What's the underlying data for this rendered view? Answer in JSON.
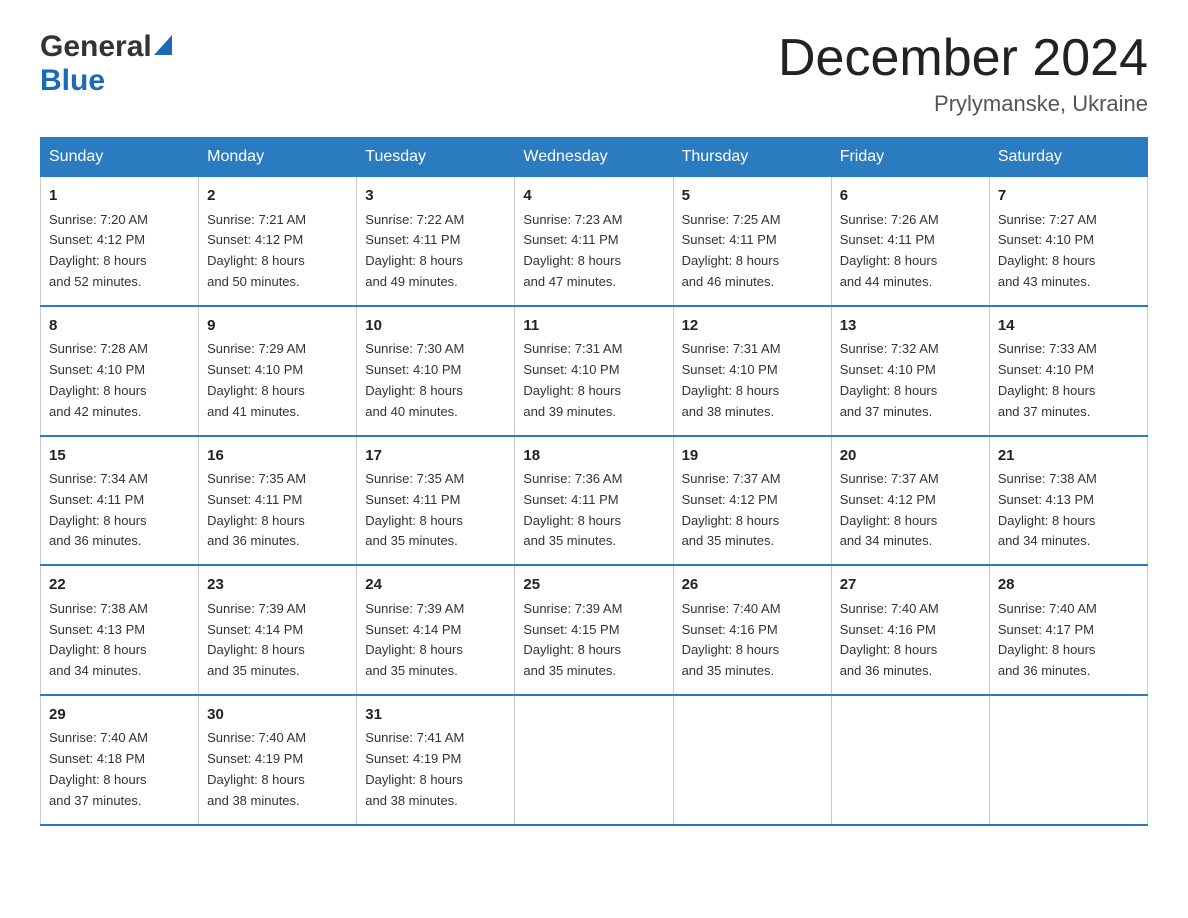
{
  "header": {
    "logo_general": "General",
    "logo_blue": "Blue",
    "title": "December 2024",
    "location": "Prylymanske, Ukraine"
  },
  "columns": [
    "Sunday",
    "Monday",
    "Tuesday",
    "Wednesday",
    "Thursday",
    "Friday",
    "Saturday"
  ],
  "weeks": [
    [
      {
        "day": "1",
        "sunrise": "7:20 AM",
        "sunset": "4:12 PM",
        "daylight": "8 hours and 52 minutes."
      },
      {
        "day": "2",
        "sunrise": "7:21 AM",
        "sunset": "4:12 PM",
        "daylight": "8 hours and 50 minutes."
      },
      {
        "day": "3",
        "sunrise": "7:22 AM",
        "sunset": "4:11 PM",
        "daylight": "8 hours and 49 minutes."
      },
      {
        "day": "4",
        "sunrise": "7:23 AM",
        "sunset": "4:11 PM",
        "daylight": "8 hours and 47 minutes."
      },
      {
        "day": "5",
        "sunrise": "7:25 AM",
        "sunset": "4:11 PM",
        "daylight": "8 hours and 46 minutes."
      },
      {
        "day": "6",
        "sunrise": "7:26 AM",
        "sunset": "4:11 PM",
        "daylight": "8 hours and 44 minutes."
      },
      {
        "day": "7",
        "sunrise": "7:27 AM",
        "sunset": "4:10 PM",
        "daylight": "8 hours and 43 minutes."
      }
    ],
    [
      {
        "day": "8",
        "sunrise": "7:28 AM",
        "sunset": "4:10 PM",
        "daylight": "8 hours and 42 minutes."
      },
      {
        "day": "9",
        "sunrise": "7:29 AM",
        "sunset": "4:10 PM",
        "daylight": "8 hours and 41 minutes."
      },
      {
        "day": "10",
        "sunrise": "7:30 AM",
        "sunset": "4:10 PM",
        "daylight": "8 hours and 40 minutes."
      },
      {
        "day": "11",
        "sunrise": "7:31 AM",
        "sunset": "4:10 PM",
        "daylight": "8 hours and 39 minutes."
      },
      {
        "day": "12",
        "sunrise": "7:31 AM",
        "sunset": "4:10 PM",
        "daylight": "8 hours and 38 minutes."
      },
      {
        "day": "13",
        "sunrise": "7:32 AM",
        "sunset": "4:10 PM",
        "daylight": "8 hours and 37 minutes."
      },
      {
        "day": "14",
        "sunrise": "7:33 AM",
        "sunset": "4:10 PM",
        "daylight": "8 hours and 37 minutes."
      }
    ],
    [
      {
        "day": "15",
        "sunrise": "7:34 AM",
        "sunset": "4:11 PM",
        "daylight": "8 hours and 36 minutes."
      },
      {
        "day": "16",
        "sunrise": "7:35 AM",
        "sunset": "4:11 PM",
        "daylight": "8 hours and 36 minutes."
      },
      {
        "day": "17",
        "sunrise": "7:35 AM",
        "sunset": "4:11 PM",
        "daylight": "8 hours and 35 minutes."
      },
      {
        "day": "18",
        "sunrise": "7:36 AM",
        "sunset": "4:11 PM",
        "daylight": "8 hours and 35 minutes."
      },
      {
        "day": "19",
        "sunrise": "7:37 AM",
        "sunset": "4:12 PM",
        "daylight": "8 hours and 35 minutes."
      },
      {
        "day": "20",
        "sunrise": "7:37 AM",
        "sunset": "4:12 PM",
        "daylight": "8 hours and 34 minutes."
      },
      {
        "day": "21",
        "sunrise": "7:38 AM",
        "sunset": "4:13 PM",
        "daylight": "8 hours and 34 minutes."
      }
    ],
    [
      {
        "day": "22",
        "sunrise": "7:38 AM",
        "sunset": "4:13 PM",
        "daylight": "8 hours and 34 minutes."
      },
      {
        "day": "23",
        "sunrise": "7:39 AM",
        "sunset": "4:14 PM",
        "daylight": "8 hours and 35 minutes."
      },
      {
        "day": "24",
        "sunrise": "7:39 AM",
        "sunset": "4:14 PM",
        "daylight": "8 hours and 35 minutes."
      },
      {
        "day": "25",
        "sunrise": "7:39 AM",
        "sunset": "4:15 PM",
        "daylight": "8 hours and 35 minutes."
      },
      {
        "day": "26",
        "sunrise": "7:40 AM",
        "sunset": "4:16 PM",
        "daylight": "8 hours and 35 minutes."
      },
      {
        "day": "27",
        "sunrise": "7:40 AM",
        "sunset": "4:16 PM",
        "daylight": "8 hours and 36 minutes."
      },
      {
        "day": "28",
        "sunrise": "7:40 AM",
        "sunset": "4:17 PM",
        "daylight": "8 hours and 36 minutes."
      }
    ],
    [
      {
        "day": "29",
        "sunrise": "7:40 AM",
        "sunset": "4:18 PM",
        "daylight": "8 hours and 37 minutes."
      },
      {
        "day": "30",
        "sunrise": "7:40 AM",
        "sunset": "4:19 PM",
        "daylight": "8 hours and 38 minutes."
      },
      {
        "day": "31",
        "sunrise": "7:41 AM",
        "sunset": "4:19 PM",
        "daylight": "8 hours and 38 minutes."
      },
      null,
      null,
      null,
      null
    ]
  ],
  "labels": {
    "sunrise": "Sunrise:",
    "sunset": "Sunset:",
    "daylight": "Daylight:"
  }
}
